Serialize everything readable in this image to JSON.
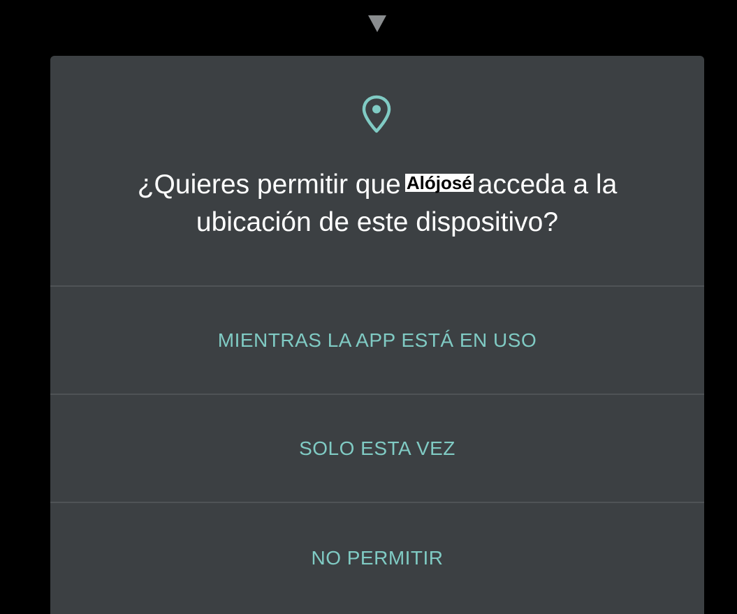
{
  "dialog": {
    "title_before": "¿Quieres permitir que",
    "app_name": "Alójosé",
    "title_after": "acceda a la ubicación de este dispositivo?",
    "icon": "location-pin-icon",
    "options": [
      {
        "label": "MIENTRAS LA APP ESTÁ EN USO"
      },
      {
        "label": "SOLO ESTA VEZ"
      },
      {
        "label": "NO PERMITIR"
      }
    ]
  },
  "colors": {
    "background": "#000000",
    "dialog_background": "#3c4043",
    "accent": "#80cbc4",
    "title_text": "#ffffff",
    "divider": "#4f5356"
  }
}
